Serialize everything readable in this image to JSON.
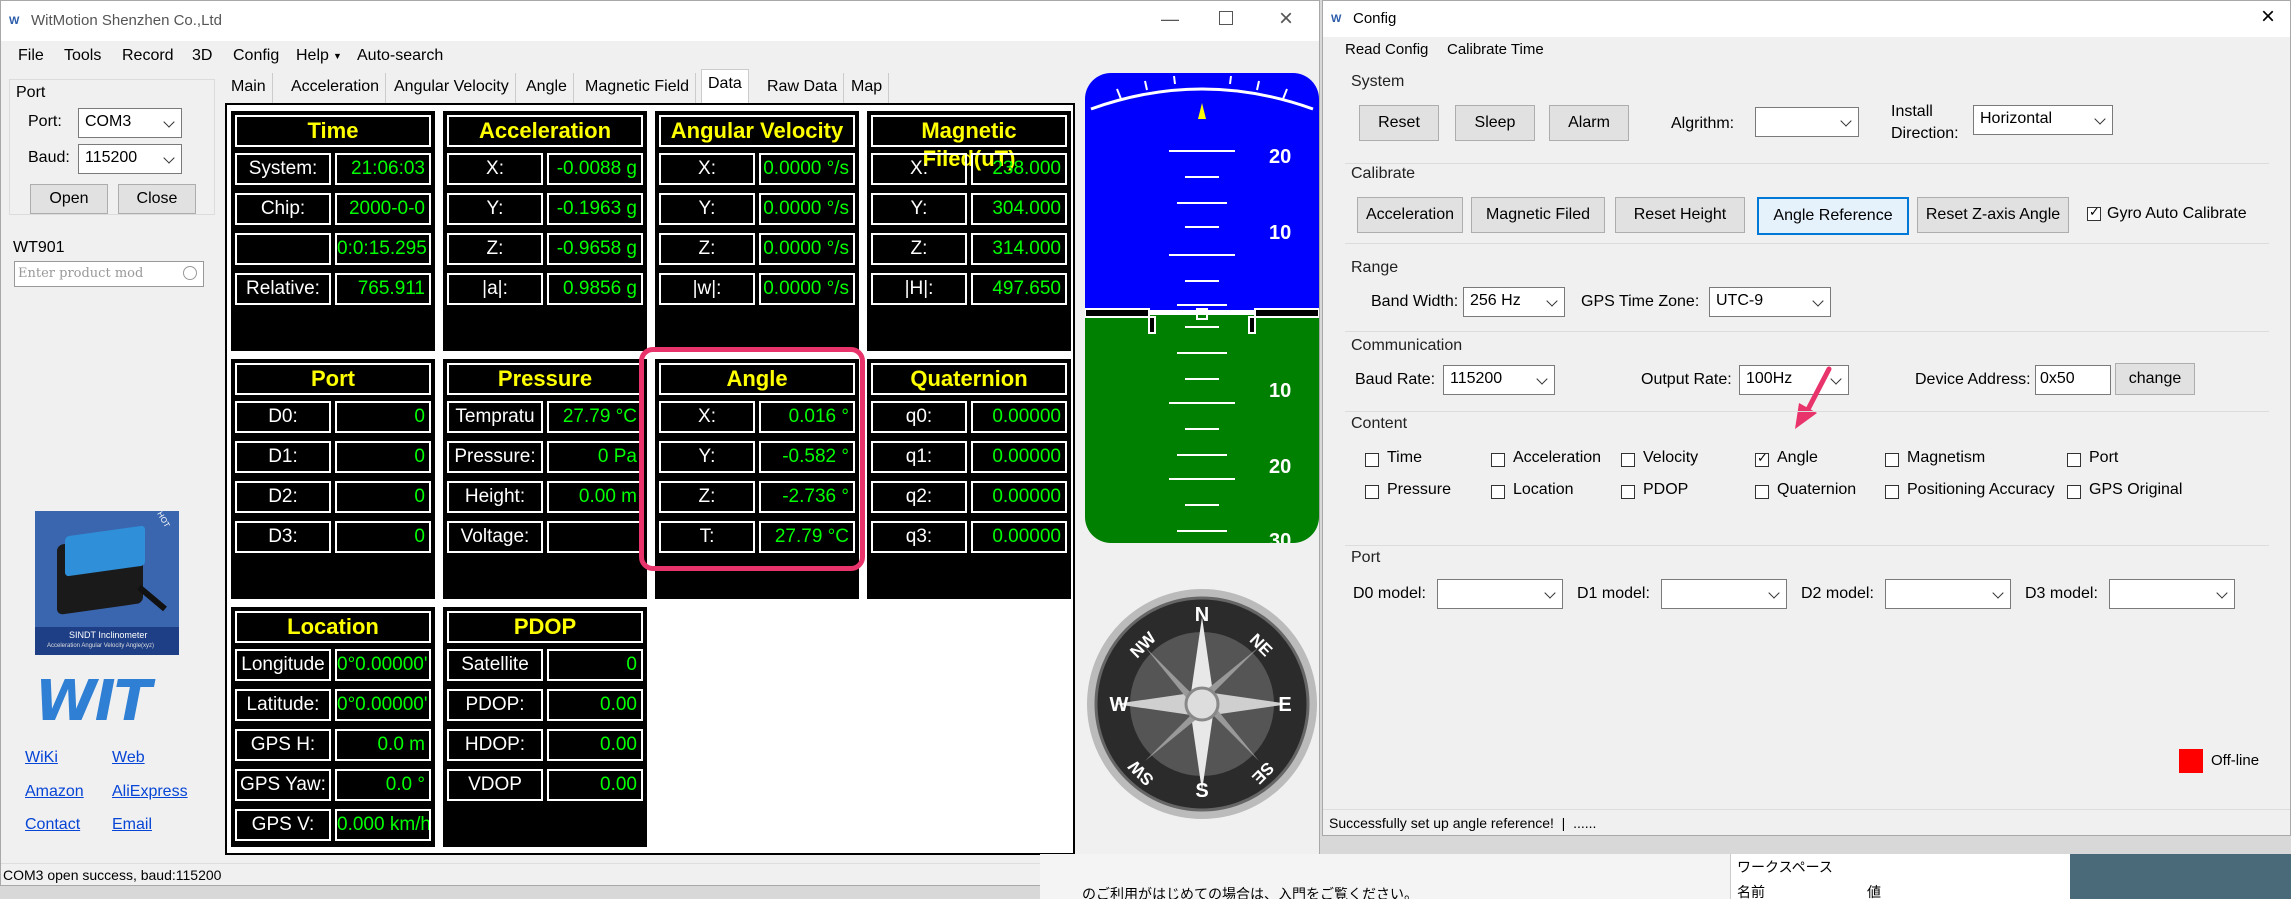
{
  "main_window": {
    "title": "WitMotion Shenzhen Co.,Ltd",
    "menu": [
      "File",
      "Tools",
      "Record",
      "3D",
      "Config",
      "Help",
      "Auto-search"
    ],
    "port_group": "Port",
    "port_label": "Port:",
    "port_value": "COM3",
    "baud_label": "Baud:",
    "baud_value": "115200",
    "open": "Open",
    "close": "Close",
    "device": "WT901",
    "search_placeholder": "Enter product mod",
    "product_image_title": "SINDT Inclinometer",
    "product_image_caption": "Acceleration Angular Velocity Angle(xyz)",
    "product_tag": "HOT",
    "logo": "WIT",
    "links": [
      "WiKi",
      "Web",
      "Amazon",
      "AliExpress",
      "Contact",
      "Email"
    ],
    "tabs": [
      "Main",
      "Acceleration",
      "Angular Velocity",
      "Angle",
      "Magnetic Field",
      "Data",
      "Raw Data",
      "Map"
    ],
    "active_tab": "Data",
    "status": "COM3 open success, baud:115200"
  },
  "panels": {
    "time": {
      "title": "Time",
      "rows": [
        [
          "System:",
          "21:06:03"
        ],
        [
          "Chip:",
          "2000-0-0"
        ],
        [
          "",
          "0:0:15.295"
        ],
        [
          "Relative:",
          "765.911"
        ]
      ]
    },
    "acceleration": {
      "title": "Acceleration",
      "rows": [
        [
          "X:",
          "-0.0088 g"
        ],
        [
          "Y:",
          "-0.1963 g"
        ],
        [
          "Z:",
          "-0.9658 g"
        ],
        [
          "|a|:",
          "0.9856 g"
        ]
      ]
    },
    "angular_velocity": {
      "title": "Angular Velocity",
      "rows": [
        [
          "X:",
          "0.0000 °/s"
        ],
        [
          "Y:",
          "0.0000 °/s"
        ],
        [
          "Z:",
          "0.0000 °/s"
        ],
        [
          "|w|:",
          "0.0000 °/s"
        ]
      ]
    },
    "magnetic": {
      "title": "Magnetic Filed(uT)",
      "rows": [
        [
          "X:",
          "238.000"
        ],
        [
          "Y:",
          "304.000"
        ],
        [
          "Z:",
          "314.000"
        ],
        [
          "|H|:",
          "497.650"
        ]
      ]
    },
    "port": {
      "title": "Port",
      "rows": [
        [
          "D0:",
          "0"
        ],
        [
          "D1:",
          "0"
        ],
        [
          "D2:",
          "0"
        ],
        [
          "D3:",
          "0"
        ]
      ]
    },
    "pressure": {
      "title": "Pressure",
      "rows": [
        [
          "Tempratu",
          "27.79 °C"
        ],
        [
          "Pressure:",
          "0 Pa"
        ],
        [
          "Height:",
          "0.00 m"
        ],
        [
          "Voltage:",
          ""
        ]
      ]
    },
    "angle": {
      "title": "Angle",
      "rows": [
        [
          "X:",
          "0.016 °"
        ],
        [
          "Y:",
          "-0.582 °"
        ],
        [
          "Z:",
          "-2.736 °"
        ],
        [
          "T:",
          "27.79 °C"
        ]
      ]
    },
    "quaternion": {
      "title": "Quaternion",
      "rows": [
        [
          "q0:",
          "0.00000"
        ],
        [
          "q1:",
          "0.00000"
        ],
        [
          "q2:",
          "0.00000"
        ],
        [
          "q3:",
          "0.00000"
        ]
      ]
    },
    "location": {
      "title": "Location",
      "rows": [
        [
          "Longitude",
          "0°0.00000'"
        ],
        [
          "Latitude:",
          "0°0.00000'"
        ],
        [
          "GPS H:",
          "0.0 m"
        ],
        [
          "GPS Yaw:",
          "0.0 °"
        ],
        [
          "GPS V:",
          "0.000 km/h"
        ]
      ]
    },
    "pdop": {
      "title": "PDOP",
      "rows": [
        [
          "Satellite",
          "0"
        ],
        [
          "PDOP:",
          "0.00"
        ],
        [
          "HDOP:",
          "0.00"
        ],
        [
          "VDOP",
          "0.00"
        ]
      ]
    }
  },
  "attitude": {
    "labels": [
      "20",
      "10",
      "10",
      "20",
      "30"
    ]
  },
  "compass": {
    "letters": [
      "N",
      "NE",
      "E",
      "SE",
      "S",
      "SW",
      "W",
      "NW"
    ]
  },
  "config": {
    "title": "Config",
    "menu": [
      "Read Config",
      "Calibrate Time"
    ],
    "system": {
      "label": "System",
      "buttons": [
        "Reset",
        "Sleep",
        "Alarm"
      ],
      "algrithm_label": "Algrithm:",
      "algrithm_value": "",
      "install_label1": "Install",
      "install_label2": "Direction:",
      "install_value": "Horizontal"
    },
    "calibrate": {
      "label": "Calibrate",
      "buttons": [
        "Acceleration",
        "Magnetic Filed",
        "Reset Height",
        "Angle Reference",
        "Reset Z-axis Angle"
      ],
      "gyro": "Gyro Auto Calibrate"
    },
    "range": {
      "label": "Range",
      "bandwidth_label": "Band Width:",
      "bandwidth_value": "256 Hz",
      "gps_tz_label": "GPS Time Zone:",
      "gps_tz_value": "UTC-9"
    },
    "communication": {
      "label": "Communication",
      "baud_label": "Baud Rate:",
      "baud_value": "115200",
      "output_label": "Output Rate:",
      "output_value": "100Hz",
      "addr_label": "Device Address:",
      "addr_value": "0x50",
      "change": "change"
    },
    "content": {
      "label": "Content",
      "items": [
        "Time",
        "Acceleration",
        "Velocity",
        "Angle",
        "Magnetism",
        "Port",
        "Pressure",
        "Location",
        "PDOP",
        "Quaternion",
        "Positioning Accuracy",
        "GPS Original"
      ],
      "checked": "Angle"
    },
    "port": {
      "label": "Port",
      "models": [
        "D0 model:",
        "D1 model:",
        "D2 model:",
        "D3 model:"
      ]
    },
    "offline": "Off-line",
    "status": "Successfully set up angle reference!  |  ......"
  },
  "background": {
    "workspace": "ワークスペース",
    "name_col": "名前",
    "value_col": "値",
    "notice": "のご利用がはじめての場合は、入門をご覧ください。"
  },
  "colors": {
    "sky": "#0000ff",
    "ground": "#008000",
    "highlight": "#e8336b",
    "panel_value": "#00ff00",
    "panel_title": "#ffff00"
  }
}
